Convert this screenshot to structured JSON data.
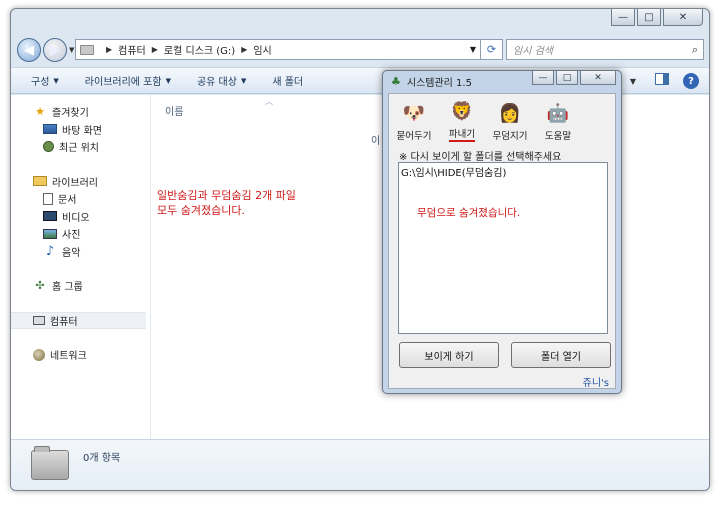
{
  "window": {
    "caption_min": "—",
    "caption_max": "□",
    "caption_close": "✕"
  },
  "address": {
    "crumbs": [
      "컴퓨터",
      "로컬 디스크 (G:)",
      "임시"
    ],
    "search_placeholder": "임시 검색"
  },
  "commands": [
    "구성",
    "라이브러리에 포함",
    "공유 대상",
    "새 폴더"
  ],
  "nav": {
    "favorites": "즐겨찾기",
    "desktop": "바탕 화면",
    "recent": "최근 위치",
    "libraries": "라이브러리",
    "documents": "문서",
    "videos": "비디오",
    "pictures": "사진",
    "music": "음악",
    "homegroup": "홈 그룹",
    "computer": "컴퓨터",
    "network": "네트워크"
  },
  "content": {
    "column_name": "이름",
    "column_partial": "이",
    "note_line1": "일반숨김과 무덤숨김 2개 파일",
    "note_line2": "모두 숨겨졌습니다."
  },
  "details": {
    "item_count": "0개 항목"
  },
  "dialog": {
    "title": "시스템관리 1.5",
    "tools": [
      "묻어두기",
      "파내기",
      "무덤지기",
      "도움말"
    ],
    "active_tool": "파내기",
    "instruction": "※ 다시 보이게 할 폴더를 선택해주세요",
    "list_path": "G:\\임시\\HIDE(무덤숨김)",
    "hidden_note": "무덤으로 숨겨졌습니다.",
    "btn_show": "보이게 하기",
    "btn_open": "폴더 열기",
    "brand": "쥬니's"
  },
  "colors": {
    "note_red": "#d11919",
    "chrome_blue": "#dde7f2",
    "brand_blue": "#1d4fa3"
  }
}
